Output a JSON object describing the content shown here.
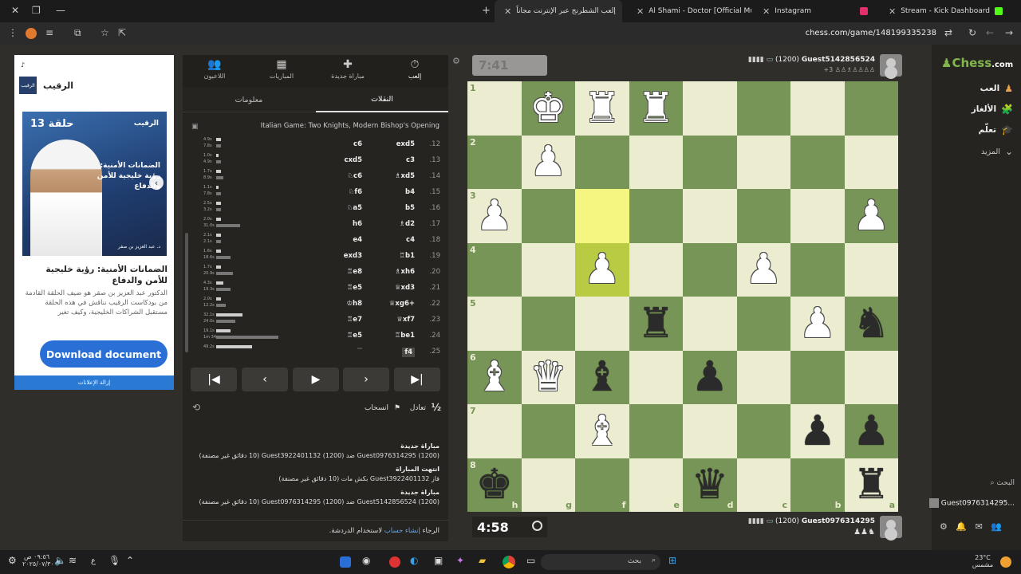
{
  "browser": {
    "tabs": [
      {
        "label": "Stream - Kick Dashboard",
        "color": "#53fc18"
      },
      {
        "label": "Instagram",
        "color": "#e1306c"
      },
      {
        "label": "Al Shami - Doctor [Official Mu",
        "color": "#ff0000"
      },
      {
        "label": "إلعب الشطرنج عبر الإنترنت مجاناً",
        "color": "#81b64c"
      }
    ],
    "url": "chess.com/game/148199335238"
  },
  "ad": {
    "name": "الرقيب",
    "logo_text": "الرقيب",
    "image_episode": "حلقة 13",
    "image_brand": "الرقيب",
    "image_title": "الضمانات الأمنية: رؤية خليجية للأمن والدفاع",
    "image_caption": "د. عبد العزيز بن صقر",
    "title": "الضمانات الأمنية: رؤية خليجية للأمن والدفاع",
    "body": "الدكتور عبد العزيز بن صقر هو ضيف الحلقة القادمة من بودكاست الرقيب نناقش في هذه الحلقة مستقبل الشراكات الخليجية، وكيف تغير",
    "button": "Download document",
    "remove": "إزالة الإعلانات"
  },
  "panel": {
    "nav": [
      {
        "label": "إلعب",
        "icon": "⏱"
      },
      {
        "label": "مباراة جديدة",
        "icon": "✚"
      },
      {
        "label": "المباريات",
        "icon": "▦"
      },
      {
        "label": "اللاعبون",
        "icon": "👥"
      }
    ],
    "subtabs": {
      "moves": "النقلات",
      "info": "معلومات"
    },
    "opening": "Italian Game: Two Knights, Modern Bishop's Opening",
    "moves": [
      {
        "n": ".12",
        "w": "exd5",
        "b": "c6",
        "t1": "4.9s",
        "t2": "7.8s",
        "b1": 2,
        "b2": 2
      },
      {
        "n": ".13",
        "w": "c3",
        "b": "cxd5",
        "t1": "1.0s",
        "t2": "4.9s",
        "b1": 1,
        "b2": 2
      },
      {
        "n": ".14",
        "w": "♗xd5",
        "b": "♘c6",
        "t1": "1.7s",
        "t2": "8.9s",
        "b1": 2,
        "b2": 3
      },
      {
        "n": ".15",
        "w": "b4",
        "b": "♘f6",
        "t1": "1.1s",
        "t2": "7.8s",
        "b1": 1,
        "b2": 2
      },
      {
        "n": ".16",
        "w": "b5",
        "b": "♘a5",
        "t1": "2.5s",
        "t2": "3.2s",
        "b1": 2,
        "b2": 2
      },
      {
        "n": ".17",
        "w": "♗d2",
        "b": "h6",
        "t1": "2.0s",
        "t2": "31.0s",
        "b1": 2,
        "b2": 10
      },
      {
        "n": ".18",
        "w": "c4",
        "b": "e4",
        "t1": "2.1s",
        "t2": "2.1s",
        "b1": 2,
        "b2": 2
      },
      {
        "n": ".19",
        "w": "♖b1",
        "b": "exd3",
        "t1": "1.6s",
        "t2": "18.6s",
        "b1": 2,
        "b2": 6
      },
      {
        "n": ".20",
        "w": "♗xh6",
        "b": "♖e8",
        "t1": "1.7s",
        "t2": "20.9s",
        "b1": 2,
        "b2": 7
      },
      {
        "n": ".21",
        "w": "♕xd3",
        "b": "♖e5",
        "t1": "4.3s",
        "t2": "19.3s",
        "b1": 3,
        "b2": 6
      },
      {
        "n": ".22",
        "w": "♕xg6+",
        "b": "♔h8",
        "t1": "2.0s",
        "t2": "12.2s",
        "b1": 2,
        "b2": 4
      },
      {
        "n": ".23",
        "w": "♕xf7",
        "b": "♖e7",
        "t1": "32.1s",
        "t2": "24.0s",
        "b1": 11,
        "b2": 8
      },
      {
        "n": ".24",
        "w": "♖be1",
        "b": "♖e5",
        "t1": "19.1s",
        "t2": "1m 34s",
        "b1": 6,
        "b2": 26
      },
      {
        "n": ".25",
        "w": "f4",
        "b": "",
        "t1": "49.2s",
        "t2": "",
        "b1": 15,
        "b2": 0
      }
    ],
    "actions": {
      "draw": "تعادل",
      "draw_icon": "½",
      "resign": "انسحاب"
    },
    "feed": [
      {
        "head": "مباراة جديدة",
        "body": "Guest0976314295 (1200) ضد Guest3922401132 (1200) (10 دقائق غير مصنفة)"
      },
      {
        "head": "انتهت المباراة",
        "body": "فاز Guest3922401132 بكش مات (10 دقائق غير مصنفة)"
      },
      {
        "head": "مباراة جديدة",
        "body": "Guest5142856524 (1200) ضد Guest0976314295 (1200) (10 دقائق غير مصنفة)"
      }
    ],
    "chat_note_pre": "الرجاء",
    "chat_note_link": "إنشاء حساب",
    "chat_note_post": "لاستخدام الدردشة."
  },
  "top_player": {
    "clock": "7:41",
    "name": "Guest5142856524",
    "rating": "(1200)",
    "sub": "+3"
  },
  "bottom_player": {
    "clock": "4:58",
    "name": "Guest0976314295",
    "rating": "(1200)"
  },
  "board": {
    "ranks": [
      "1",
      "2",
      "3",
      "4",
      "5",
      "6",
      "7",
      "8"
    ],
    "files": [
      "h",
      "g",
      "f",
      "e",
      "d",
      "c",
      "b",
      "a"
    ],
    "highlights": [
      "2-2",
      "3-2"
    ],
    "pieces": [
      {
        "r": 0,
        "c": 1,
        "p": "♚",
        "w": true
      },
      {
        "r": 0,
        "c": 2,
        "p": "♜",
        "w": true
      },
      {
        "r": 0,
        "c": 3,
        "p": "♜",
        "w": true
      },
      {
        "r": 1,
        "c": 1,
        "p": "♟",
        "w": true
      },
      {
        "r": 2,
        "c": 0,
        "p": "♟",
        "w": true
      },
      {
        "r": 2,
        "c": 7,
        "p": "♟",
        "w": true
      },
      {
        "r": 3,
        "c": 2,
        "p": "♟",
        "w": true
      },
      {
        "r": 3,
        "c": 5,
        "p": "♟",
        "w": true
      },
      {
        "r": 4,
        "c": 3,
        "p": "♜",
        "w": false
      },
      {
        "r": 4,
        "c": 6,
        "p": "♟",
        "w": true
      },
      {
        "r": 4,
        "c": 7,
        "p": "♞",
        "w": false
      },
      {
        "r": 5,
        "c": 0,
        "p": "♝",
        "w": true
      },
      {
        "r": 5,
        "c": 1,
        "p": "♛",
        "w": true
      },
      {
        "r": 5,
        "c": 2,
        "p": "♝",
        "w": false
      },
      {
        "r": 5,
        "c": 4,
        "p": "♟",
        "w": false
      },
      {
        "r": 6,
        "c": 2,
        "p": "♝",
        "w": true
      },
      {
        "r": 6,
        "c": 6,
        "p": "♟",
        "w": false
      },
      {
        "r": 6,
        "c": 7,
        "p": "♟",
        "w": false
      },
      {
        "r": 7,
        "c": 0,
        "p": "♚",
        "w": false
      },
      {
        "r": 7,
        "c": 4,
        "p": "♛",
        "w": false
      },
      {
        "r": 7,
        "c": 7,
        "p": "♜",
        "w": false
      }
    ]
  },
  "sidebar": {
    "logo_a": "♟Chess",
    "logo_b": ".com",
    "items": [
      {
        "label": "العب",
        "icon": "♟"
      },
      {
        "label": "الألغاز",
        "icon": "🧩"
      },
      {
        "label": "تعلّم",
        "icon": "🎓"
      },
      {
        "label": "المزيد",
        "icon": "⌄"
      }
    ],
    "search": "البحث",
    "user": "Guest0976314295..."
  },
  "taskbar": {
    "search": "بحث",
    "weather_temp": "23°C",
    "weather_desc": "مشمس",
    "time": "٠٩:٥٦ ص",
    "date": "٢٠٢٥/٠٧/٣٠",
    "lang": "ع"
  }
}
